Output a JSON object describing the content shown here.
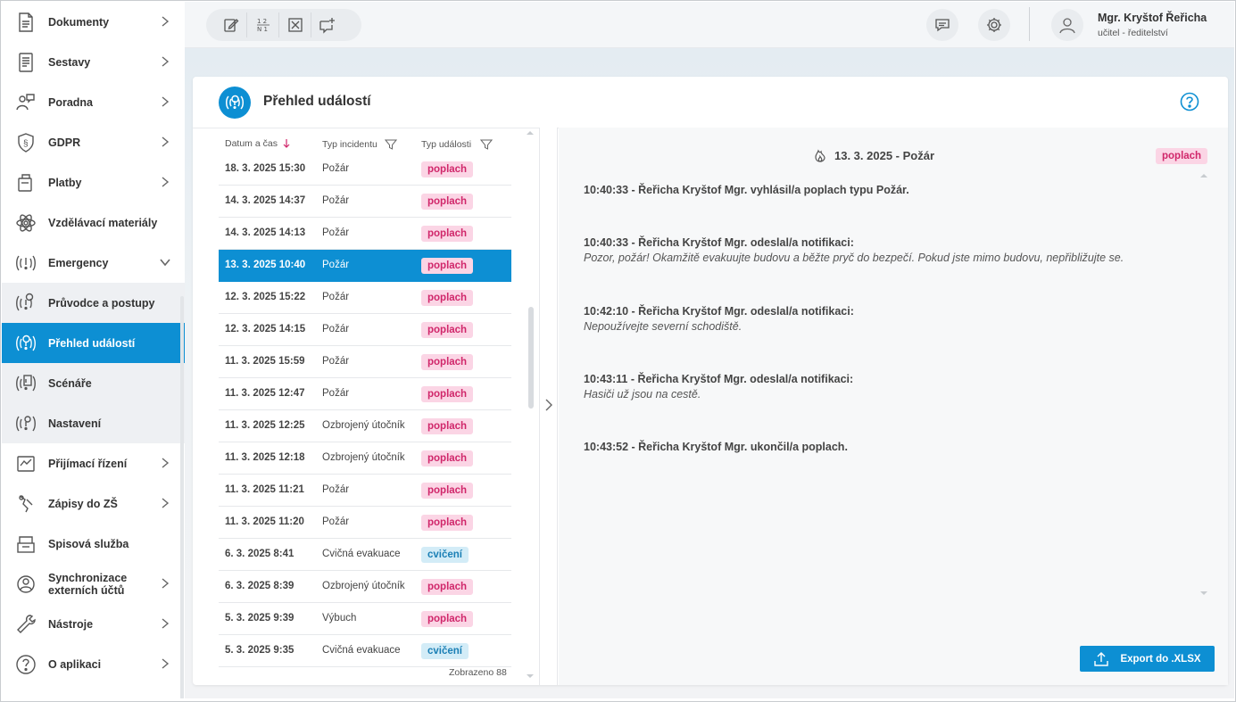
{
  "sidebar": {
    "items": [
      {
        "label": "Dokumenty",
        "icon": "document-icon",
        "chevron": "right"
      },
      {
        "label": "Sestavy",
        "icon": "report-icon",
        "chevron": "right"
      },
      {
        "label": "Poradna",
        "icon": "counseling-icon",
        "chevron": "right"
      },
      {
        "label": "GDPR",
        "icon": "shield-icon",
        "chevron": "right"
      },
      {
        "label": "Platby",
        "icon": "payment-icon",
        "chevron": "right"
      },
      {
        "label": "Vzdělávací materiály",
        "icon": "atom-icon",
        "chevron": ""
      },
      {
        "label": "Emergency",
        "icon": "emergency-icon",
        "chevron": "down"
      },
      {
        "label": "Průvodce a postupy",
        "icon": "emergency-guide-icon",
        "chevron": ""
      },
      {
        "label": "Přehled událostí",
        "icon": "emergency-events-icon",
        "chevron": ""
      },
      {
        "label": "Scénáře",
        "icon": "emergency-scenario-icon",
        "chevron": ""
      },
      {
        "label": "Nastavení",
        "icon": "emergency-settings-icon",
        "chevron": ""
      },
      {
        "label": "Přijímací řízení",
        "icon": "admission-icon",
        "chevron": "right"
      },
      {
        "label": "Zápisy do ZŠ",
        "icon": "enrollment-icon",
        "chevron": "right"
      },
      {
        "label": "Spisová služba",
        "icon": "archive-icon",
        "chevron": ""
      },
      {
        "label": "Synchronizace externích účtů",
        "icon": "sync-icon",
        "chevron": "right"
      },
      {
        "label": "Nástroje",
        "icon": "wrench-icon",
        "chevron": "right"
      },
      {
        "label": "O aplikaci",
        "icon": "question-icon",
        "chevron": "right"
      }
    ]
  },
  "topbar": {
    "tools": [
      "edit-icon",
      "numbering-icon",
      "close-box-icon",
      "add-comment-icon"
    ],
    "user": {
      "name": "Mgr. Kryštof Řeřicha",
      "role": "učitel - ředitelství"
    }
  },
  "page": {
    "title": "Přehled událostí"
  },
  "list": {
    "headers": {
      "date": "Datum a čas",
      "incident": "Typ incidentu",
      "event": "Typ události"
    },
    "rows": [
      {
        "date": "18. 3. 2025 15:30",
        "type": "Požár",
        "badge": "poplach",
        "kind": "alarm"
      },
      {
        "date": "14. 3. 2025 14:37",
        "type": "Požár",
        "badge": "poplach",
        "kind": "alarm"
      },
      {
        "date": "14. 3. 2025 14:13",
        "type": "Požár",
        "badge": "poplach",
        "kind": "alarm"
      },
      {
        "date": "13. 3. 2025 10:40",
        "type": "Požár",
        "badge": "poplach",
        "kind": "alarm",
        "selected": true
      },
      {
        "date": "12. 3. 2025 15:22",
        "type": "Požár",
        "badge": "poplach",
        "kind": "alarm"
      },
      {
        "date": "12. 3. 2025 14:15",
        "type": "Požár",
        "badge": "poplach",
        "kind": "alarm"
      },
      {
        "date": "11. 3. 2025 15:59",
        "type": "Požár",
        "badge": "poplach",
        "kind": "alarm"
      },
      {
        "date": "11. 3. 2025 12:47",
        "type": "Požár",
        "badge": "poplach",
        "kind": "alarm"
      },
      {
        "date": "11. 3. 2025 12:25",
        "type": "Ozbrojený útočník",
        "badge": "poplach",
        "kind": "alarm"
      },
      {
        "date": "11. 3. 2025 12:18",
        "type": "Ozbrojený útočník",
        "badge": "poplach",
        "kind": "alarm"
      },
      {
        "date": "11. 3. 2025 11:21",
        "type": "Požár",
        "badge": "poplach",
        "kind": "alarm"
      },
      {
        "date": "11. 3. 2025 11:20",
        "type": "Požár",
        "badge": "poplach",
        "kind": "alarm"
      },
      {
        "date": "6. 3. 2025 8:41",
        "type": "Cvičná evakuace",
        "badge": "cvičení",
        "kind": "drill"
      },
      {
        "date": "6. 3. 2025 8:39",
        "type": "Ozbrojený útočník",
        "badge": "poplach",
        "kind": "alarm"
      },
      {
        "date": "5. 3. 2025 9:39",
        "type": "Výbuch",
        "badge": "poplach",
        "kind": "alarm"
      },
      {
        "date": "5. 3. 2025 9:35",
        "type": "Cvičná evakuace",
        "badge": "cvičení",
        "kind": "drill"
      }
    ],
    "shown": "Zobrazeno 88"
  },
  "detail": {
    "title": "13. 3. 2025 - Požár",
    "badge": "poplach",
    "events": [
      {
        "line": "10:40:33 - Řeřicha Kryštof Mgr. vyhlásil/a poplach typu Požár.",
        "message": ""
      },
      {
        "line": "10:40:33 - Řeřicha Kryštof Mgr. odeslal/a notifikaci:",
        "message": "Pozor, požár! Okamžitě evakuujte budovu a běžte pryč do bezpečí. Pokud jste mimo budovu, nepřibližujte se."
      },
      {
        "line": "10:42:10 - Řeřicha Kryštof Mgr. odeslal/a notifikaci:",
        "message": "Nepoužívejte severní schodiště."
      },
      {
        "line": "10:43:11 - Řeřicha Kryštof Mgr. odeslal/a notifikaci:",
        "message": "Hasiči už jsou na cestě."
      },
      {
        "line": "10:43:52 - Řeřicha Kryštof Mgr. ukončil/a poplach.",
        "message": ""
      }
    ],
    "export_label": "Export do .XLSX"
  },
  "colors": {
    "accent": "#0d8fd3",
    "alarm_bg": "#fbd5e5",
    "alarm_fg": "#d0266a",
    "drill_bg": "#d3ecf7",
    "drill_fg": "#1a7fb5"
  }
}
